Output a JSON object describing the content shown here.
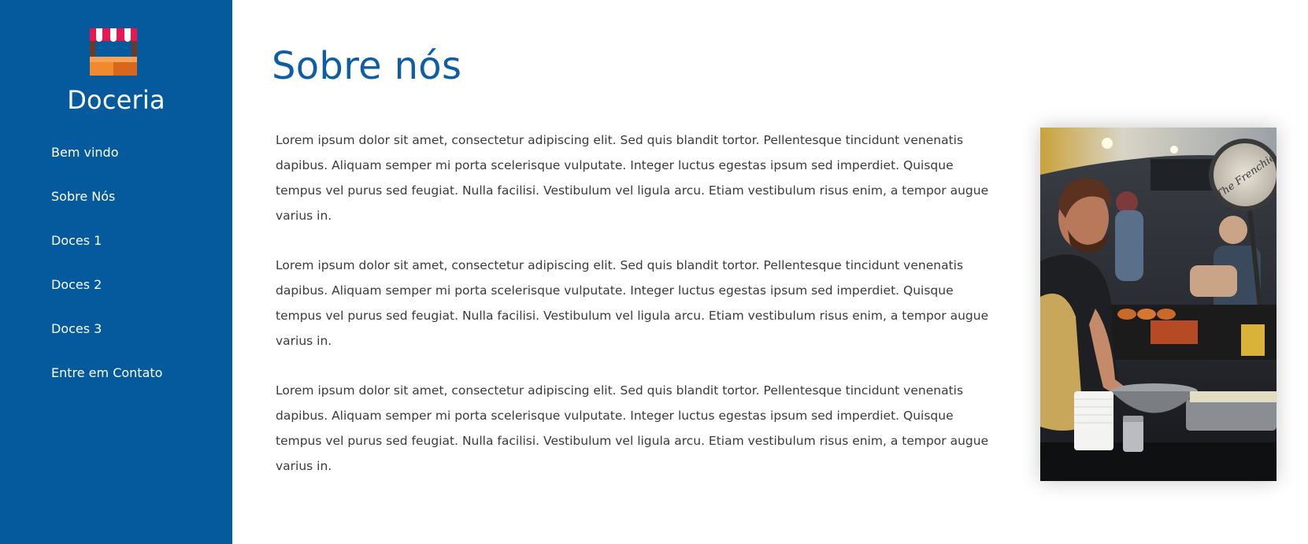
{
  "brand": {
    "name": "Doceria",
    "logo_icon": "market-stall-icon"
  },
  "nav": {
    "items": [
      {
        "label": "Bem vindo"
      },
      {
        "label": "Sobre Nós"
      },
      {
        "label": "Doces 1"
      },
      {
        "label": "Doces 2"
      },
      {
        "label": "Doces 3"
      },
      {
        "label": "Entre em Contato"
      }
    ]
  },
  "main": {
    "title": "Sobre nós",
    "paragraphs": [
      "Lorem ipsum dolor sit amet, consectetur adipiscing elit. Sed quis blandit tortor. Pellentesque tincidunt venenatis dapibus. Aliquam semper mi porta scelerisque vulputate. Integer luctus egestas ipsum sed imperdiet. Quisque tempus vel purus sed feugiat. Nulla facilisi. Vestibulum vel ligula arcu. Etiam vestibulum risus enim, a tempor augue varius in.",
      "Lorem ipsum dolor sit amet, consectetur adipiscing elit. Sed quis blandit tortor. Pellentesque tincidunt venenatis dapibus. Aliquam semper mi porta scelerisque vulputate. Integer luctus egestas ipsum sed imperdiet. Quisque tempus vel purus sed feugiat. Nulla facilisi. Vestibulum vel ligula arcu. Etiam vestibulum risus enim, a tempor augue varius in.",
      "Lorem ipsum dolor sit amet, consectetur adipiscing elit. Sed quis blandit tortor. Pellentesque tincidunt venenatis dapibus. Aliquam semper mi porta scelerisque vulputate. Integer luctus egestas ipsum sed imperdiet. Quisque tempus vel purus sed feugiat. Nulla facilisi. Vestibulum vel ligula arcu. Etiam vestibulum risus enim, a tempor augue varius in."
    ],
    "photo": {
      "sign_text": "The Frenchie"
    }
  },
  "colors": {
    "sidebar": "#045a9c",
    "title": "#0f5ea3",
    "body_text": "#3a3a3a"
  }
}
